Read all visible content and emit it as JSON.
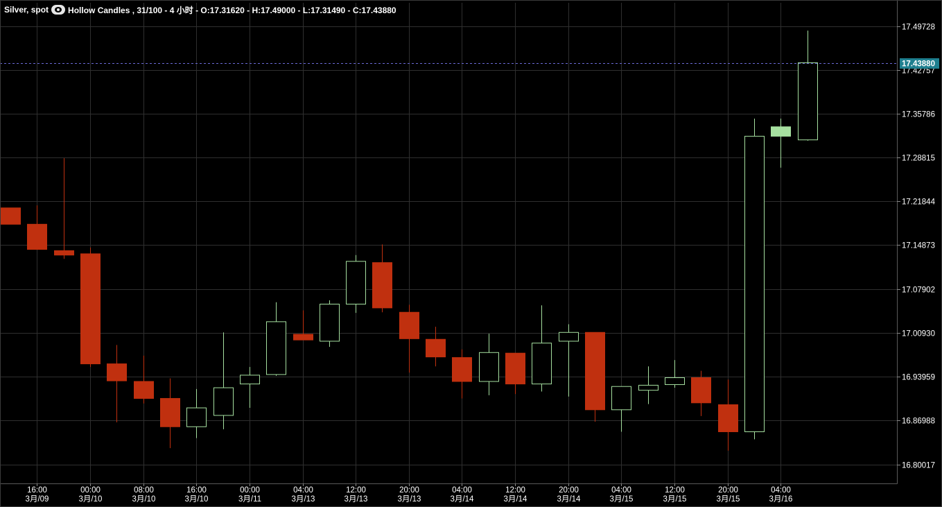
{
  "header": {
    "instrument": "Silver, spot",
    "chart_label": "Hollow Candles , 31/100 - 4 小时 - O:17.31620 - H:17.49000 - L:17.31490 - C:17.43880"
  },
  "colors": {
    "background": "#000000",
    "grid": "#2f2f2f",
    "up": "#a6e0a0",
    "down": "#c0300f",
    "axis_text": "#ffffff",
    "last_price_bg": "#1e7f8f"
  },
  "chart_data": {
    "type": "candlestick",
    "style": "hollow",
    "ylim": [
      16.775,
      17.515
    ],
    "y_ticks": [
      "17.49728",
      "17.42757",
      "17.35786",
      "17.28815",
      "17.21844",
      "17.14873",
      "17.07902",
      "17.00930",
      "16.93959",
      "16.86988",
      "16.80017"
    ],
    "last_price": "17.43880",
    "x_ticks": [
      {
        "index": 1,
        "time": "16:00",
        "date": "3月/09"
      },
      {
        "index": 3,
        "time": "00:00",
        "date": "3月/10"
      },
      {
        "index": 5,
        "time": "08:00",
        "date": "3月/10"
      },
      {
        "index": 7,
        "time": "16:00",
        "date": "3月/10"
      },
      {
        "index": 9,
        "time": "00:00",
        "date": "3月/11"
      },
      {
        "index": 11,
        "time": "04:00",
        "date": "3月/13"
      },
      {
        "index": 13,
        "time": "12:00",
        "date": "3月/13"
      },
      {
        "index": 15,
        "time": "20:00",
        "date": "3月/13"
      },
      {
        "index": 17,
        "time": "04:00",
        "date": "3月/14"
      },
      {
        "index": 19,
        "time": "12:00",
        "date": "3月/14"
      },
      {
        "index": 21,
        "time": "20:00",
        "date": "3月/14"
      },
      {
        "index": 23,
        "time": "04:00",
        "date": "3月/15"
      },
      {
        "index": 25,
        "time": "12:00",
        "date": "3月/15"
      },
      {
        "index": 27,
        "time": "20:00",
        "date": "3月/15"
      },
      {
        "index": 29,
        "time": "04:00",
        "date": "3月/16"
      }
    ],
    "candles": [
      {
        "o": 17.208,
        "h": 17.208,
        "l": 17.182,
        "c": 17.182
      },
      {
        "o": 17.182,
        "h": 17.212,
        "l": 17.142,
        "c": 17.142
      },
      {
        "o": 17.14,
        "h": 17.287,
        "l": 17.127,
        "c": 17.133
      },
      {
        "o": 17.135,
        "h": 17.145,
        "l": 16.955,
        "c": 16.96
      },
      {
        "o": 16.96,
        "h": 16.99,
        "l": 16.867,
        "c": 16.933
      },
      {
        "o": 16.932,
        "h": 16.973,
        "l": 16.897,
        "c": 16.905
      },
      {
        "o": 16.905,
        "h": 16.937,
        "l": 16.826,
        "c": 16.86
      },
      {
        "o": 16.86,
        "h": 16.92,
        "l": 16.842,
        "c": 16.89
      },
      {
        "o": 16.878,
        "h": 17.01,
        "l": 16.856,
        "c": 16.922
      },
      {
        "o": 16.928,
        "h": 16.955,
        "l": 16.89,
        "c": 16.942
      },
      {
        "o": 16.943,
        "h": 17.058,
        "l": 16.941,
        "c": 17.027
      },
      {
        "o": 17.007,
        "h": 17.045,
        "l": 16.998,
        "c": 16.998
      },
      {
        "o": 16.996,
        "h": 17.061,
        "l": 16.987,
        "c": 17.055
      },
      {
        "o": 17.055,
        "h": 17.133,
        "l": 17.041,
        "c": 17.123
      },
      {
        "o": 17.121,
        "h": 17.15,
        "l": 17.042,
        "c": 17.049
      },
      {
        "o": 17.042,
        "h": 17.054,
        "l": 16.946,
        "c": 17.0
      },
      {
        "o": 16.999,
        "h": 17.019,
        "l": 16.956,
        "c": 16.971
      },
      {
        "o": 16.97,
        "h": 16.983,
        "l": 16.905,
        "c": 16.932
      },
      {
        "o": 16.932,
        "h": 17.008,
        "l": 16.91,
        "c": 16.978
      },
      {
        "o": 16.977,
        "h": 16.977,
        "l": 16.912,
        "c": 16.928
      },
      {
        "o": 16.928,
        "h": 17.053,
        "l": 16.916,
        "c": 16.993
      },
      {
        "o": 16.996,
        "h": 17.023,
        "l": 16.908,
        "c": 17.01
      },
      {
        "o": 17.01,
        "h": 17.01,
        "l": 16.868,
        "c": 16.887
      },
      {
        "o": 16.887,
        "h": 16.924,
        "l": 16.852,
        "c": 16.924
      },
      {
        "o": 16.918,
        "h": 16.956,
        "l": 16.896,
        "c": 16.926
      },
      {
        "o": 16.927,
        "h": 16.966,
        "l": 16.922,
        "c": 16.938
      },
      {
        "o": 16.938,
        "h": 16.949,
        "l": 16.877,
        "c": 16.898
      },
      {
        "o": 16.895,
        "h": 16.935,
        "l": 16.822,
        "c": 16.852
      },
      {
        "o": 16.852,
        "h": 17.35,
        "l": 16.84,
        "c": 17.322
      },
      {
        "o": 17.322,
        "h": 17.35,
        "l": 17.272,
        "c": 17.337
      },
      {
        "o": 17.3162,
        "h": 17.49,
        "l": 17.3149,
        "c": 17.4388
      }
    ]
  }
}
